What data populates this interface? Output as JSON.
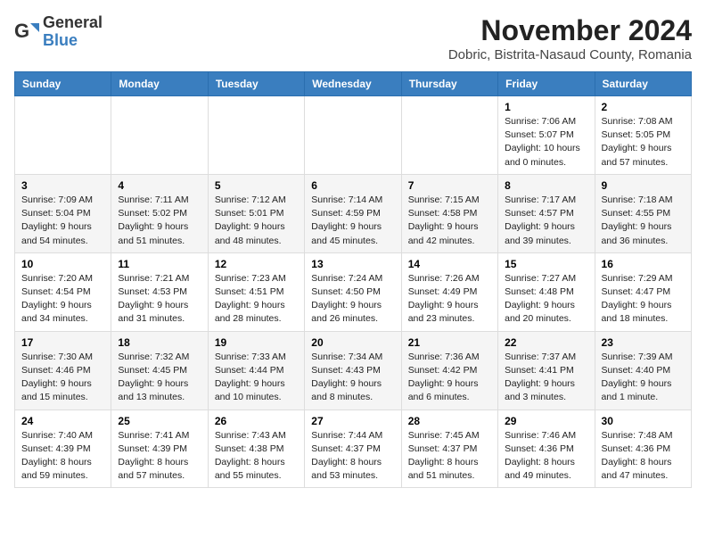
{
  "logo": {
    "general": "General",
    "blue": "Blue"
  },
  "title": "November 2024",
  "subtitle": "Dobric, Bistrita-Nasaud County, Romania",
  "weekdays": [
    "Sunday",
    "Monday",
    "Tuesday",
    "Wednesday",
    "Thursday",
    "Friday",
    "Saturday"
  ],
  "weeks": [
    [
      {
        "day": "",
        "info": ""
      },
      {
        "day": "",
        "info": ""
      },
      {
        "day": "",
        "info": ""
      },
      {
        "day": "",
        "info": ""
      },
      {
        "day": "",
        "info": ""
      },
      {
        "day": "1",
        "info": "Sunrise: 7:06 AM\nSunset: 5:07 PM\nDaylight: 10 hours\nand 0 minutes."
      },
      {
        "day": "2",
        "info": "Sunrise: 7:08 AM\nSunset: 5:05 PM\nDaylight: 9 hours\nand 57 minutes."
      }
    ],
    [
      {
        "day": "3",
        "info": "Sunrise: 7:09 AM\nSunset: 5:04 PM\nDaylight: 9 hours\nand 54 minutes."
      },
      {
        "day": "4",
        "info": "Sunrise: 7:11 AM\nSunset: 5:02 PM\nDaylight: 9 hours\nand 51 minutes."
      },
      {
        "day": "5",
        "info": "Sunrise: 7:12 AM\nSunset: 5:01 PM\nDaylight: 9 hours\nand 48 minutes."
      },
      {
        "day": "6",
        "info": "Sunrise: 7:14 AM\nSunset: 4:59 PM\nDaylight: 9 hours\nand 45 minutes."
      },
      {
        "day": "7",
        "info": "Sunrise: 7:15 AM\nSunset: 4:58 PM\nDaylight: 9 hours\nand 42 minutes."
      },
      {
        "day": "8",
        "info": "Sunrise: 7:17 AM\nSunset: 4:57 PM\nDaylight: 9 hours\nand 39 minutes."
      },
      {
        "day": "9",
        "info": "Sunrise: 7:18 AM\nSunset: 4:55 PM\nDaylight: 9 hours\nand 36 minutes."
      }
    ],
    [
      {
        "day": "10",
        "info": "Sunrise: 7:20 AM\nSunset: 4:54 PM\nDaylight: 9 hours\nand 34 minutes."
      },
      {
        "day": "11",
        "info": "Sunrise: 7:21 AM\nSunset: 4:53 PM\nDaylight: 9 hours\nand 31 minutes."
      },
      {
        "day": "12",
        "info": "Sunrise: 7:23 AM\nSunset: 4:51 PM\nDaylight: 9 hours\nand 28 minutes."
      },
      {
        "day": "13",
        "info": "Sunrise: 7:24 AM\nSunset: 4:50 PM\nDaylight: 9 hours\nand 26 minutes."
      },
      {
        "day": "14",
        "info": "Sunrise: 7:26 AM\nSunset: 4:49 PM\nDaylight: 9 hours\nand 23 minutes."
      },
      {
        "day": "15",
        "info": "Sunrise: 7:27 AM\nSunset: 4:48 PM\nDaylight: 9 hours\nand 20 minutes."
      },
      {
        "day": "16",
        "info": "Sunrise: 7:29 AM\nSunset: 4:47 PM\nDaylight: 9 hours\nand 18 minutes."
      }
    ],
    [
      {
        "day": "17",
        "info": "Sunrise: 7:30 AM\nSunset: 4:46 PM\nDaylight: 9 hours\nand 15 minutes."
      },
      {
        "day": "18",
        "info": "Sunrise: 7:32 AM\nSunset: 4:45 PM\nDaylight: 9 hours\nand 13 minutes."
      },
      {
        "day": "19",
        "info": "Sunrise: 7:33 AM\nSunset: 4:44 PM\nDaylight: 9 hours\nand 10 minutes."
      },
      {
        "day": "20",
        "info": "Sunrise: 7:34 AM\nSunset: 4:43 PM\nDaylight: 9 hours\nand 8 minutes."
      },
      {
        "day": "21",
        "info": "Sunrise: 7:36 AM\nSunset: 4:42 PM\nDaylight: 9 hours\nand 6 minutes."
      },
      {
        "day": "22",
        "info": "Sunrise: 7:37 AM\nSunset: 4:41 PM\nDaylight: 9 hours\nand 3 minutes."
      },
      {
        "day": "23",
        "info": "Sunrise: 7:39 AM\nSunset: 4:40 PM\nDaylight: 9 hours\nand 1 minute."
      }
    ],
    [
      {
        "day": "24",
        "info": "Sunrise: 7:40 AM\nSunset: 4:39 PM\nDaylight: 8 hours\nand 59 minutes."
      },
      {
        "day": "25",
        "info": "Sunrise: 7:41 AM\nSunset: 4:39 PM\nDaylight: 8 hours\nand 57 minutes."
      },
      {
        "day": "26",
        "info": "Sunrise: 7:43 AM\nSunset: 4:38 PM\nDaylight: 8 hours\nand 55 minutes."
      },
      {
        "day": "27",
        "info": "Sunrise: 7:44 AM\nSunset: 4:37 PM\nDaylight: 8 hours\nand 53 minutes."
      },
      {
        "day": "28",
        "info": "Sunrise: 7:45 AM\nSunset: 4:37 PM\nDaylight: 8 hours\nand 51 minutes."
      },
      {
        "day": "29",
        "info": "Sunrise: 7:46 AM\nSunset: 4:36 PM\nDaylight: 8 hours\nand 49 minutes."
      },
      {
        "day": "30",
        "info": "Sunrise: 7:48 AM\nSunset: 4:36 PM\nDaylight: 8 hours\nand 47 minutes."
      }
    ]
  ]
}
